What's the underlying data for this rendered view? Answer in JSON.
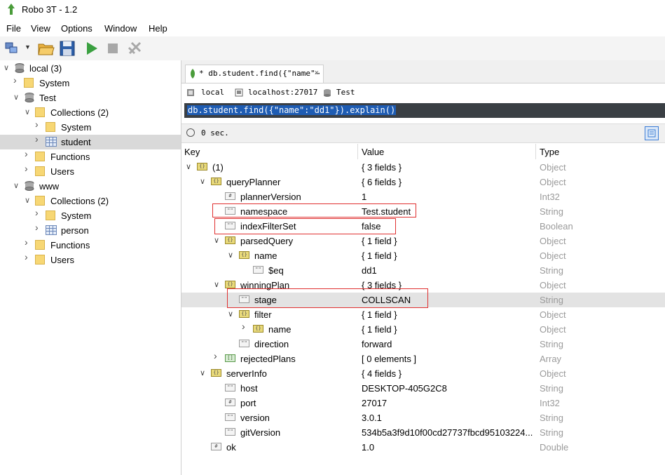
{
  "window": {
    "title": "Robo 3T - 1.2"
  },
  "menu": [
    "File",
    "View",
    "Options",
    "Window",
    "Help"
  ],
  "sidebar": {
    "items": [
      {
        "label": "local (3)",
        "icon": "server-icon",
        "level": 0,
        "expanded": true
      },
      {
        "label": "System",
        "icon": "folder-icon",
        "level": 1,
        "expanded": false
      },
      {
        "label": "Test",
        "icon": "database-icon",
        "level": 1,
        "expanded": true
      },
      {
        "label": "Collections (2)",
        "icon": "folder-icon",
        "level": 2,
        "expanded": true
      },
      {
        "label": "System",
        "icon": "folder-icon",
        "level": 3,
        "expanded": false
      },
      {
        "label": "student",
        "icon": "table-icon",
        "level": 3,
        "expanded": false,
        "selected": true
      },
      {
        "label": "Functions",
        "icon": "folder-icon",
        "level": 2,
        "expanded": false
      },
      {
        "label": "Users",
        "icon": "folder-icon",
        "level": 2,
        "expanded": false
      },
      {
        "label": "www",
        "icon": "database-icon",
        "level": 1,
        "expanded": true
      },
      {
        "label": "Collections (2)",
        "icon": "folder-icon",
        "level": 2,
        "expanded": true
      },
      {
        "label": "System",
        "icon": "folder-icon",
        "level": 3,
        "expanded": false
      },
      {
        "label": "person",
        "icon": "table-icon",
        "level": 3,
        "expanded": false
      },
      {
        "label": "Functions",
        "icon": "folder-icon",
        "level": 2,
        "expanded": false
      },
      {
        "label": "Users",
        "icon": "folder-icon",
        "level": 2,
        "expanded": false
      }
    ]
  },
  "tab": {
    "label": "* db.student.find({\"name\"⋯",
    "close": "×"
  },
  "connection": {
    "server": "local",
    "host": "localhost:27017",
    "database": "Test"
  },
  "query": {
    "text": "db.student.find({\"name\":\"dd1\"}).explain()"
  },
  "status": {
    "time": "0 sec."
  },
  "results": {
    "headers": {
      "key": "Key",
      "value": "Value",
      "type": "Type"
    },
    "rows": [
      {
        "key": "(1)",
        "value": "{ 3 fields }",
        "type": "Object",
        "depth": 0,
        "icon": "obj",
        "chev": "open"
      },
      {
        "key": "queryPlanner",
        "value": "{ 6 fields }",
        "type": "Object",
        "depth": 1,
        "icon": "obj",
        "chev": "open"
      },
      {
        "key": "plannerVersion",
        "value": "1",
        "type": "Int32",
        "depth": 2,
        "icon": "num",
        "chev": ""
      },
      {
        "key": "namespace",
        "value": "Test.student",
        "type": "String",
        "depth": 2,
        "icon": "str",
        "chev": ""
      },
      {
        "key": "indexFilterSet",
        "value": "false",
        "type": "Boolean",
        "depth": 2,
        "icon": "str",
        "chev": ""
      },
      {
        "key": "parsedQuery",
        "value": "{ 1 field }",
        "type": "Object",
        "depth": 2,
        "icon": "obj",
        "chev": "open"
      },
      {
        "key": "name",
        "value": "{ 1 field }",
        "type": "Object",
        "depth": 3,
        "icon": "obj",
        "chev": "open"
      },
      {
        "key": "$eq",
        "value": "dd1",
        "type": "String",
        "depth": 4,
        "icon": "str",
        "chev": ""
      },
      {
        "key": "winningPlan",
        "value": "{ 3 fields }",
        "type": "Object",
        "depth": 2,
        "icon": "obj",
        "chev": "open"
      },
      {
        "key": "stage",
        "value": "COLLSCAN",
        "type": "String",
        "depth": 3,
        "icon": "str",
        "chev": "",
        "highlight": true
      },
      {
        "key": "filter",
        "value": "{ 1 field }",
        "type": "Object",
        "depth": 3,
        "icon": "obj",
        "chev": "open"
      },
      {
        "key": "name",
        "value": "{ 1 field }",
        "type": "Object",
        "depth": 4,
        "icon": "obj",
        "chev": "closed"
      },
      {
        "key": "direction",
        "value": "forward",
        "type": "String",
        "depth": 3,
        "icon": "str",
        "chev": ""
      },
      {
        "key": "rejectedPlans",
        "value": "[ 0 elements ]",
        "type": "Array",
        "depth": 2,
        "icon": "arr",
        "chev": "closed"
      },
      {
        "key": "serverInfo",
        "value": "{ 4 fields }",
        "type": "Object",
        "depth": 1,
        "icon": "obj",
        "chev": "open"
      },
      {
        "key": "host",
        "value": "DESKTOP-405G2C8",
        "type": "String",
        "depth": 2,
        "icon": "str",
        "chev": ""
      },
      {
        "key": "port",
        "value": "27017",
        "type": "Int32",
        "depth": 2,
        "icon": "num",
        "chev": ""
      },
      {
        "key": "version",
        "value": "3.0.1",
        "type": "String",
        "depth": 2,
        "icon": "str",
        "chev": ""
      },
      {
        "key": "gitVersion",
        "value": "534b5a3f9d10f00cd27737fbcd95103224...",
        "type": "String",
        "depth": 2,
        "icon": "str",
        "chev": ""
      },
      {
        "key": "ok",
        "value": "1.0",
        "type": "Double",
        "depth": 1,
        "icon": "num",
        "chev": ""
      }
    ]
  },
  "colors": {
    "accent": "#1e5cb3",
    "annotation": "#e03030",
    "querybar": "#3a3f44"
  }
}
